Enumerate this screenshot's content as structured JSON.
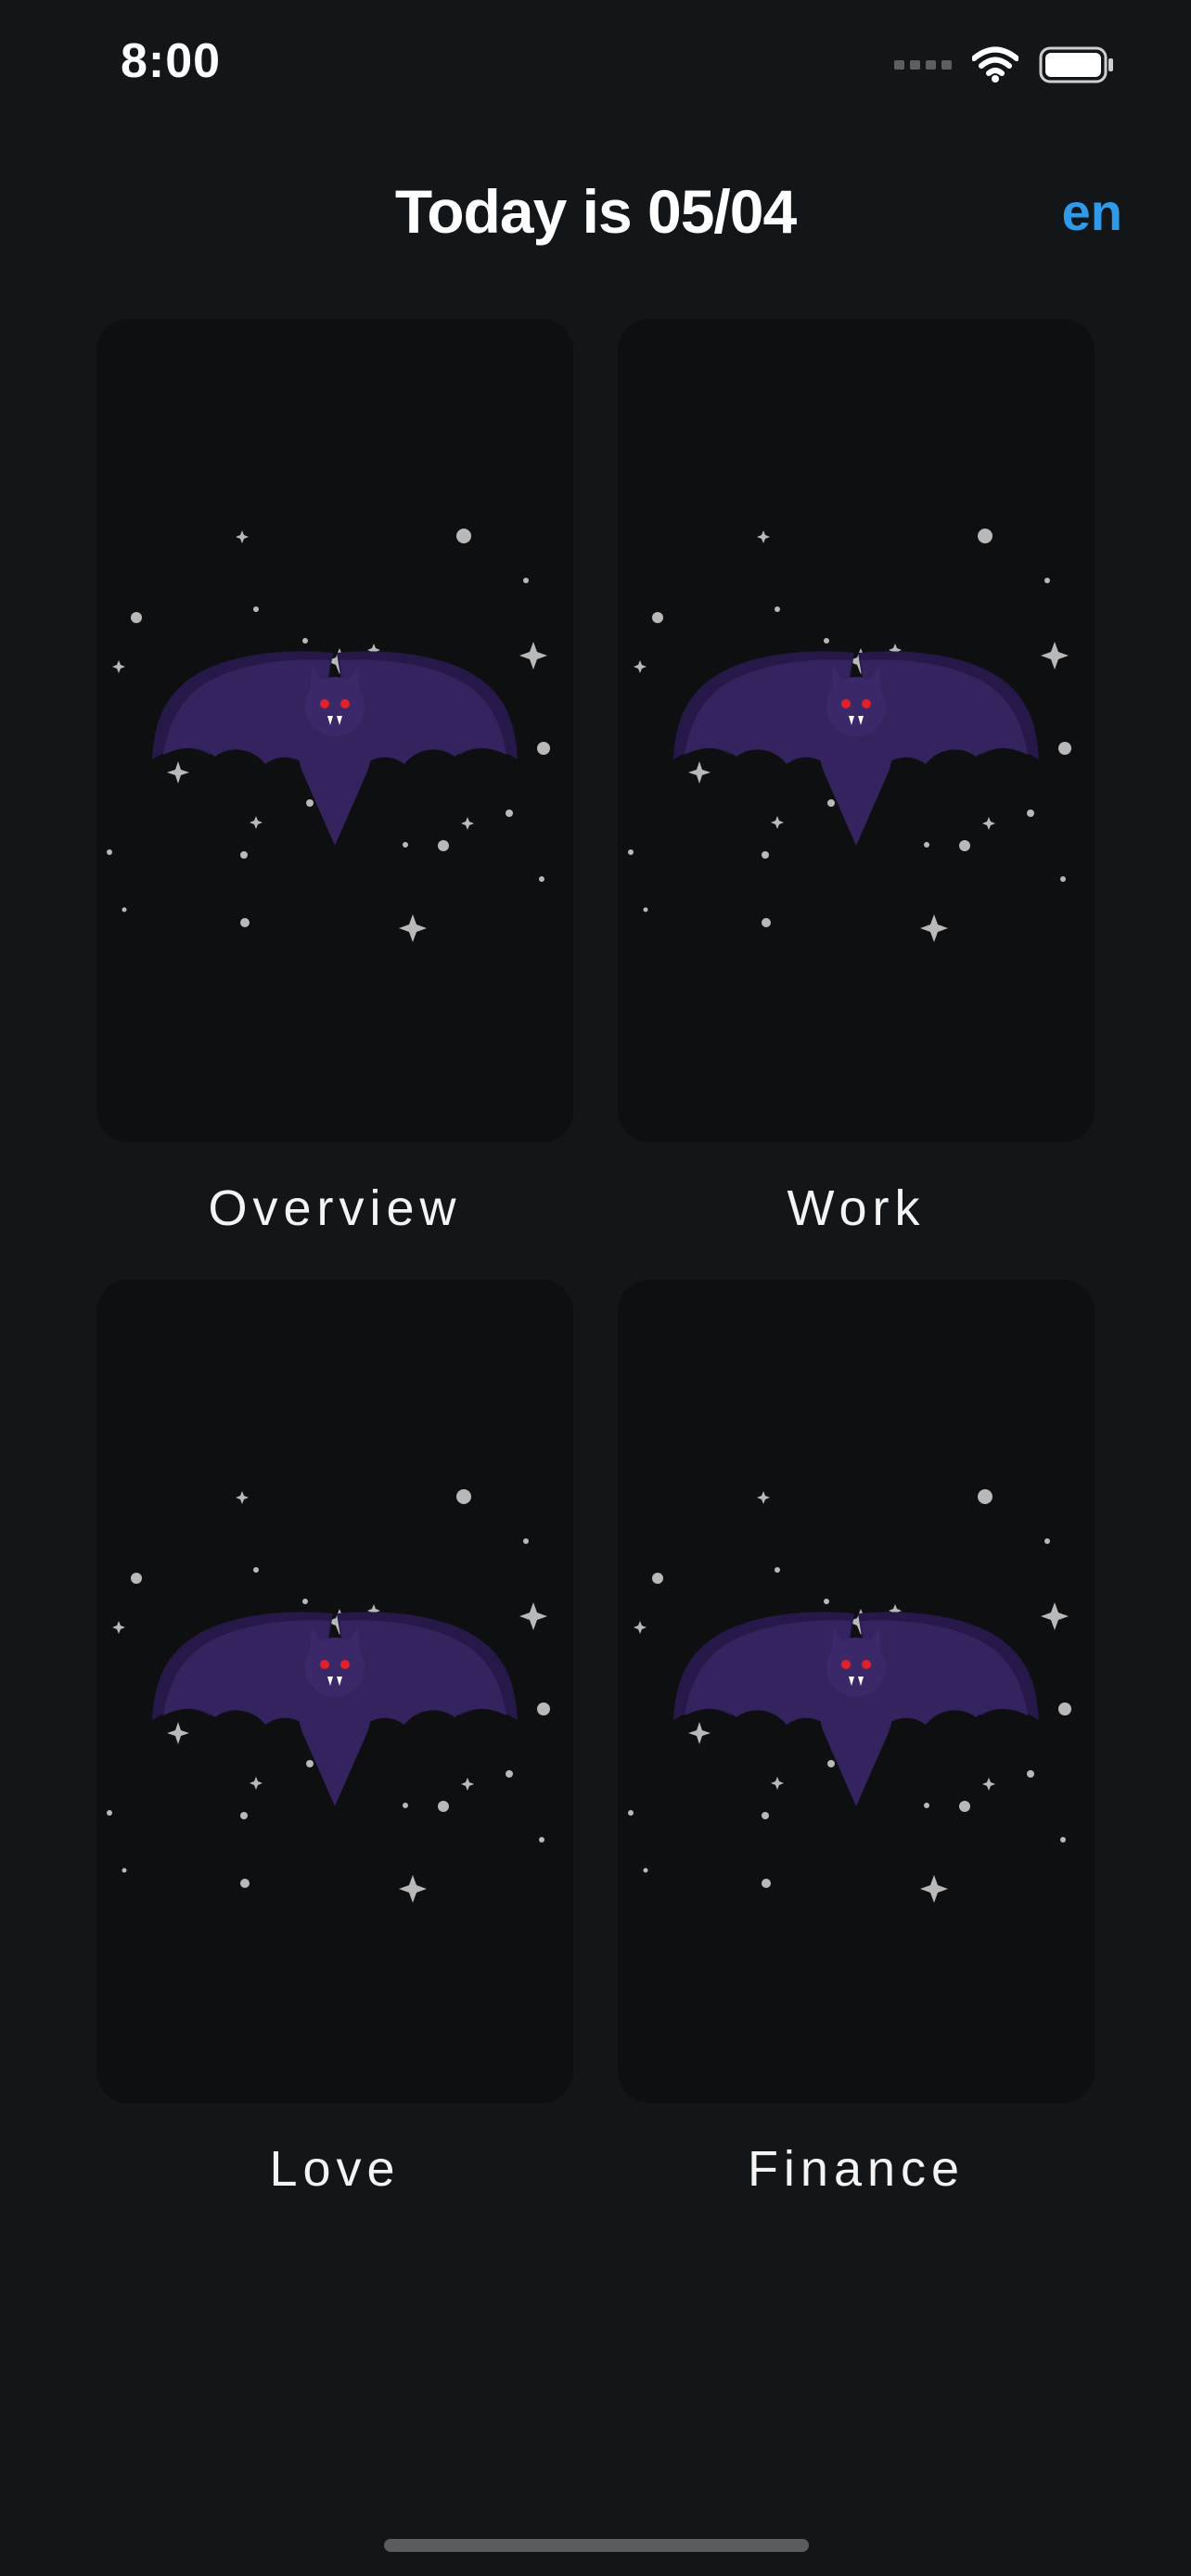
{
  "status_bar": {
    "time": "8:00",
    "icons": [
      "signal-icon",
      "wifi-icon",
      "battery-icon"
    ]
  },
  "header": {
    "title": "Today is 05/04",
    "language": "en"
  },
  "colors": {
    "background": "#131619",
    "card": "#0d0f11",
    "accent": "#2f9be8",
    "bat": "#34235f",
    "bat_dark": "#26194a",
    "bat_eyes": "#e0202a",
    "stars": "#b9b9b9"
  },
  "cards": [
    {
      "label": "Overview",
      "image": "bat-illustration"
    },
    {
      "label": "Work",
      "image": "bat-illustration"
    },
    {
      "label": "Love",
      "image": "bat-illustration"
    },
    {
      "label": "Finance",
      "image": "bat-illustration"
    }
  ]
}
